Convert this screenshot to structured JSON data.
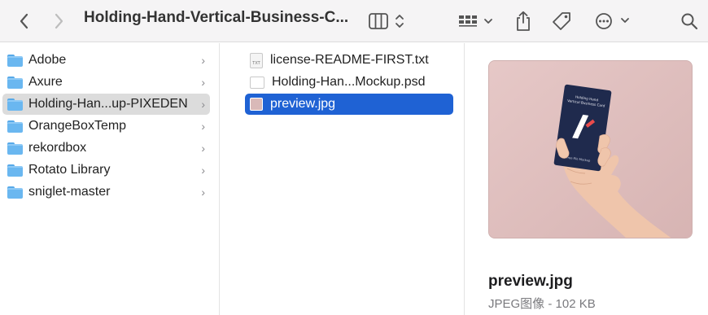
{
  "toolbar": {
    "title": "Holding-Hand-Vertical-Business-C...",
    "back_icon": "chevron-left",
    "forward_icon": "chevron-right",
    "view_icon": "columns-view",
    "group_icon": "grid-group",
    "share_icon": "share",
    "tag_icon": "tag",
    "more_icon": "ellipsis-circle",
    "search_icon": "magnifying-glass"
  },
  "sidebar": {
    "items": [
      {
        "label": "Adobe"
      },
      {
        "label": "Axure"
      },
      {
        "label": "Holding-Han...up-PIXEDEN"
      },
      {
        "label": "OrangeBoxTemp"
      },
      {
        "label": "rekordbox"
      },
      {
        "label": "Rotato Library"
      },
      {
        "label": "sniglet-master"
      }
    ],
    "chevron": "›"
  },
  "files": {
    "items": [
      {
        "label": "license-README-FIRST.txt",
        "icon_text": "TXT"
      },
      {
        "label": "Holding-Han...Mockup.psd"
      },
      {
        "label": "preview.jpg"
      }
    ]
  },
  "preview": {
    "card_line1": "Holding Hand",
    "card_line2": "Vertical Business Card",
    "card_bottom": "Free File Mockup",
    "filename": "preview.jpg",
    "info": "JPEG图像 - 102 KB"
  },
  "colors": {
    "selection_blue": "#1f62d4",
    "folder_blue": "#6ab7f0",
    "preview_bg": "#dfbfbe",
    "card_navy": "#1f2a4d"
  }
}
